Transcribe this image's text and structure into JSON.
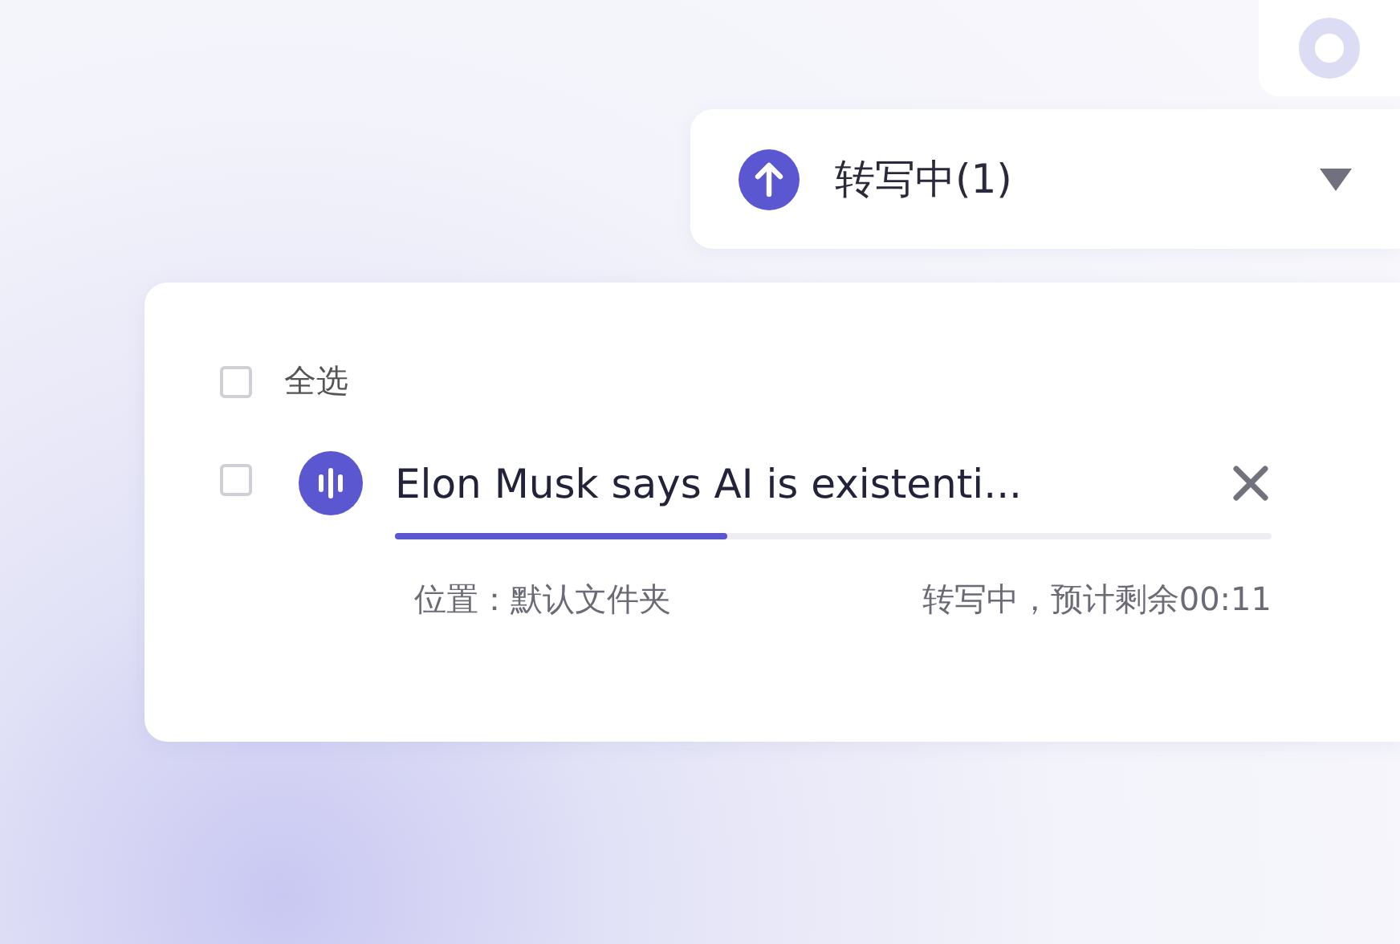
{
  "header": {
    "title": "转写中(1)"
  },
  "list": {
    "select_all": {
      "label": "全选",
      "checked": false
    },
    "items": [
      {
        "name": "Elon Musk says AI is existenti...",
        "checked": false,
        "level": 0.38,
        "location": "位置：默认文件夹",
        "status": "转写中，预计剩余00:11"
      }
    ]
  }
}
